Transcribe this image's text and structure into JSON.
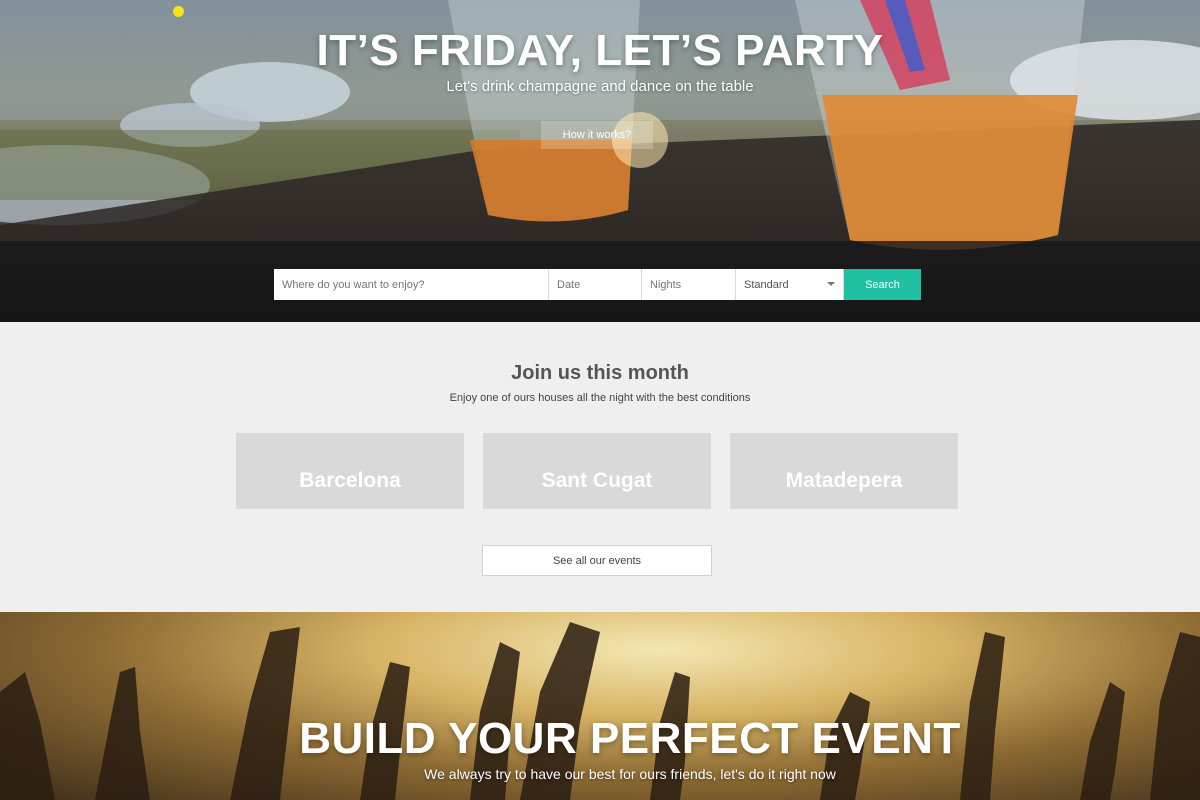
{
  "hero": {
    "title": "IT’S FRIDAY, LET’S PARTY",
    "subtitle": "Let's drink champagne and dance on the table",
    "how_button": "How it works?"
  },
  "search": {
    "where_placeholder": "Where do you want to enjoy?",
    "date_placeholder": "Date",
    "nights_placeholder": "Nights",
    "room_type_selected": "Standard",
    "search_button": "Search",
    "accent_color": "#1ec1a2"
  },
  "events": {
    "title": "Join us this month",
    "subtitle": "Enjoy one of ours houses all the night with the best conditions",
    "cities": [
      "Barcelona",
      "Sant Cugat",
      "Matadepera"
    ],
    "see_all_button": "See all our events"
  },
  "build": {
    "title": "BUILD YOUR PERFECT EVENT",
    "subtitle": "We always try to have our best for ours friends, let's do it right now"
  }
}
